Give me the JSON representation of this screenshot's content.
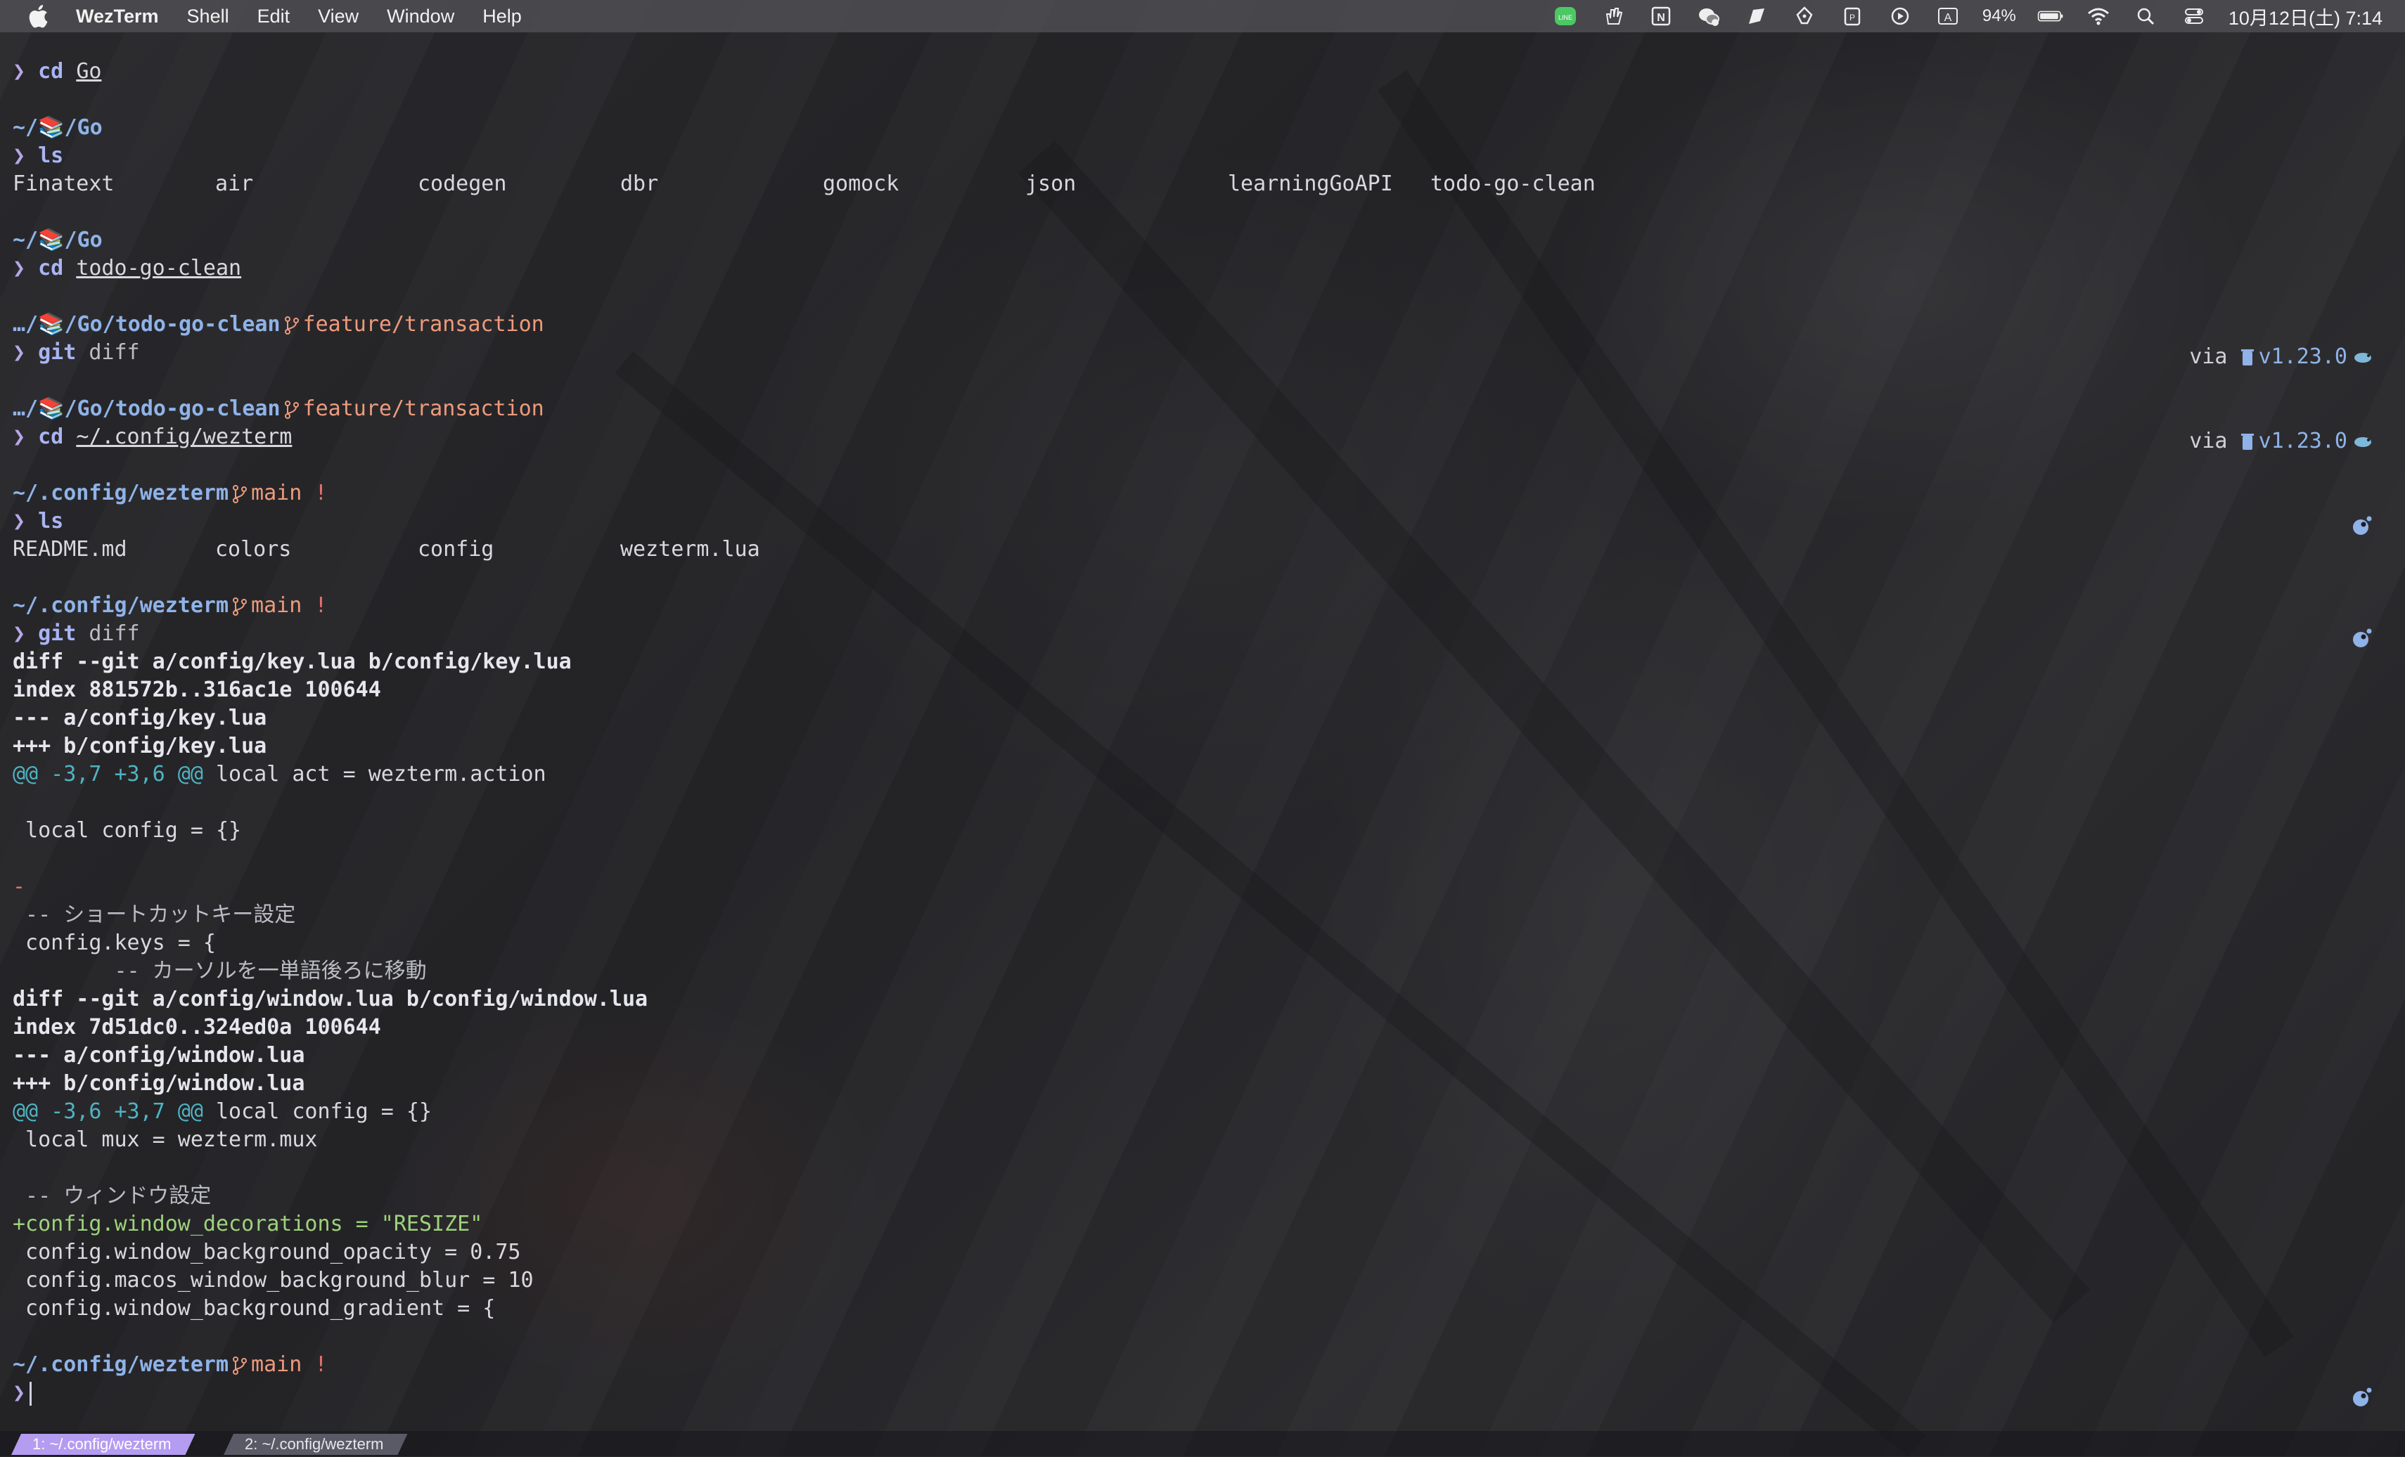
{
  "menubar": {
    "app_name": "WezTerm",
    "items": [
      "Shell",
      "Edit",
      "View",
      "Window",
      "Help"
    ],
    "battery": "94%",
    "clock": "10月12日(土) 7:14"
  },
  "terminal": {
    "prompt_char": "❯",
    "lines": {
      "l0_cmd": "cd",
      "l0_arg": "Go",
      "l2_dir": "~/📚/Go",
      "l3_cmd": "ls",
      "ls1": [
        "Finatext",
        "air",
        "codegen",
        "dbr",
        "gomock",
        "json",
        "learningGoAPI",
        "todo-go-clean"
      ],
      "l6_dir": "~/📚/Go",
      "l7_cmd": "cd",
      "l7_arg": "todo-go-clean",
      "l9_dir": "…/📚/Go/todo-go-clean",
      "l9_branch": "feature/transaction",
      "l10_cmd": "git",
      "l10_rest": "diff",
      "l12_dir": "…/📚/Go/todo-go-clean",
      "l12_branch": "feature/transaction",
      "l13_cmd": "cd",
      "l13_arg": "~/.config/wezterm",
      "l15_dir": "~/.config/wezterm",
      "l15_branch": "main",
      "l15_dirty": "!",
      "l16_cmd": "ls",
      "ls2": [
        "README.md",
        "colors",
        "config",
        "wezterm.lua"
      ],
      "l19_dir": "~/.config/wezterm",
      "l19_branch": "main",
      "l19_dirty": "!",
      "l20_cmd": "git",
      "l20_rest": "diff",
      "d1": "diff --git a/config/key.lua b/config/key.lua",
      "d2": "index 881572b..316ac1e 100644",
      "d3": "--- a/config/key.lua",
      "d4": "+++ b/config/key.lua",
      "d5_hunk": "@@ -3,7 +3,6 @@",
      "d5_ctx": " local act = wezterm.action",
      "d7": " local config = {}",
      "d9": "-",
      "d10": " -- ショートカットキー設定",
      "d11": " config.keys = {",
      "d12": "        -- カーソルを一単語後ろに移動",
      "e1": "diff --git a/config/window.lua b/config/window.lua",
      "e2": "index 7d51dc0..324ed0a 100644",
      "e3": "--- a/config/window.lua",
      "e4": "+++ b/config/window.lua",
      "e5_hunk": "@@ -3,6 +3,7 @@",
      "e5_ctx": " local config = {}",
      "e6": " local mux = wezterm.mux",
      "e8": " -- ウィンドウ設定",
      "e9": "+config.window_decorations = \"RESIZE\"",
      "e10": " config.window_background_opacity = 0.75",
      "e11": " config.macos_window_background_blur = 10",
      "e12": " config.window_background_gradient = {",
      "f1_dir": "~/.config/wezterm",
      "f1_branch": "main",
      "f1_dirty": "!"
    },
    "right_via": "via",
    "go_version": "v1.23.0"
  },
  "tabs": [
    {
      "label": "1: ~/.config/wezterm",
      "active": true
    },
    {
      "label": "2: ~/.config/wezterm",
      "active": false
    }
  ]
}
